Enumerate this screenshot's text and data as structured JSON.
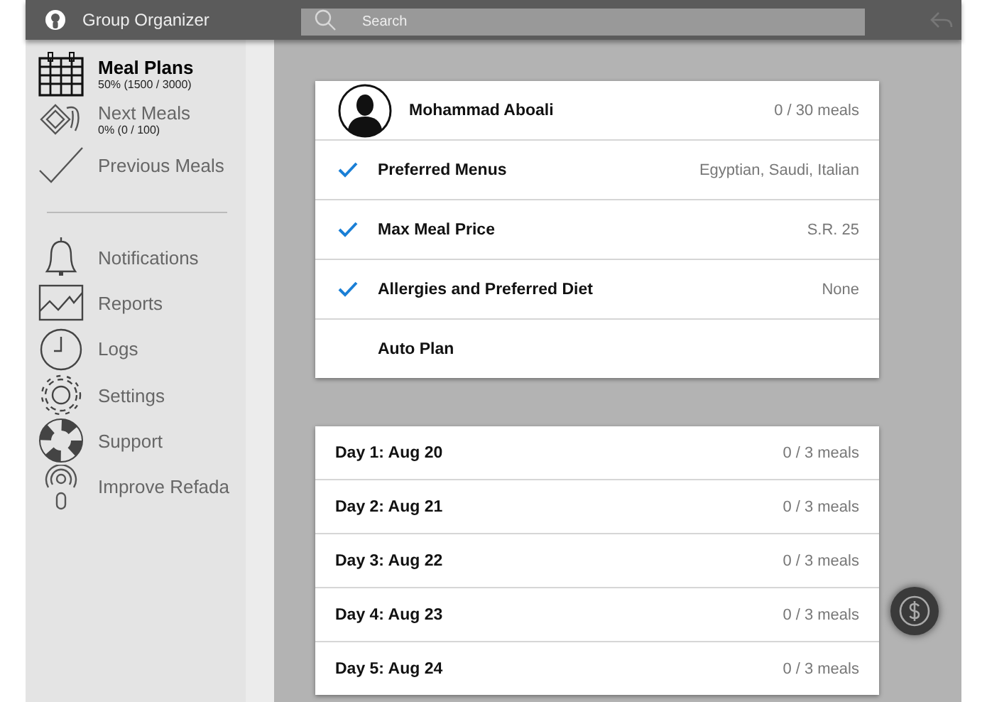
{
  "top_bar": {
    "title": "Group Organizer",
    "search": {
      "placeholder": "Search"
    }
  },
  "sidebar": {
    "primary_items": [
      {
        "label": "Meal Plans",
        "subtitle": "50% (1500 / 3000)",
        "selected": true
      },
      {
        "label": "Next Meals",
        "subtitle": "0% (0 / 100)",
        "selected": false
      },
      {
        "label": "Previous Meals",
        "selected": false
      }
    ],
    "secondary_items": [
      {
        "label": "Notifications"
      },
      {
        "label": "Reports"
      },
      {
        "label": "Logs"
      },
      {
        "label": "Settings"
      },
      {
        "label": "Support"
      },
      {
        "label": "Improve Refada"
      }
    ]
  },
  "profile_card": {
    "name": "Mohammad Aboali",
    "meals": "0 / 30 meals",
    "settings": [
      {
        "label": "Preferred Menus",
        "value": "Egyptian, Saudi, Italian",
        "checked": true
      },
      {
        "label": "Max Meal Price",
        "value": "S.R. 25",
        "checked": true
      },
      {
        "label": "Allergies and Preferred Diet",
        "value": "None",
        "checked": true
      },
      {
        "label": "Auto Plan",
        "checked": false
      }
    ]
  },
  "days": [
    {
      "label": "Day 1: Aug 20",
      "meals": "0 / 3 meals"
    },
    {
      "label": "Day 2: Aug 21",
      "meals": "0 / 3 meals"
    },
    {
      "label": "Day 3: Aug 22",
      "meals": "0 / 3 meals"
    },
    {
      "label": "Day 4: Aug 23",
      "meals": "0 / 3 meals"
    },
    {
      "label": "Day 5: Aug 24",
      "meals": "0 / 3 meals"
    }
  ]
}
